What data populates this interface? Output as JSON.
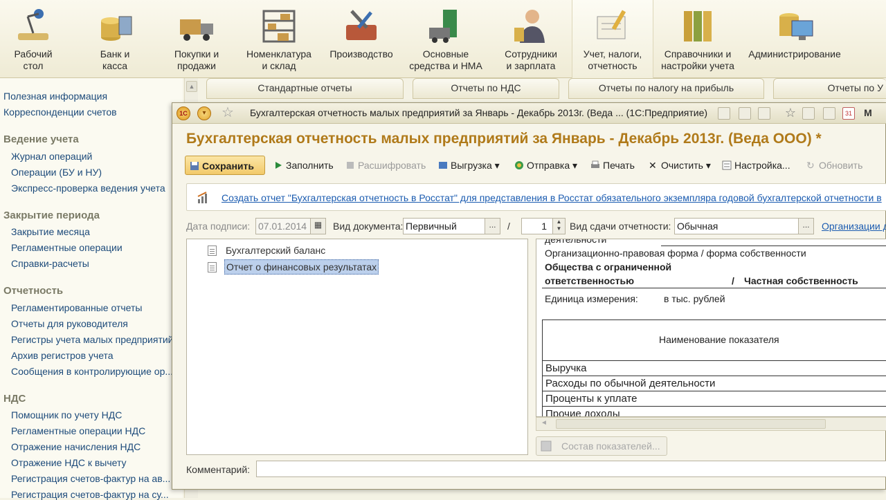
{
  "sections": [
    {
      "name": "desktop",
      "label": "Рабочий\nстол",
      "icon": "desk-lamp-icon"
    },
    {
      "name": "bank",
      "label": "Банк и\nкасса",
      "icon": "coins-icon"
    },
    {
      "name": "purchases",
      "label": "Покупки и\nпродажи",
      "icon": "truck-icon"
    },
    {
      "name": "nomenclature",
      "label": "Номенклатура\nи склад",
      "icon": "warehouse-icon"
    },
    {
      "name": "production",
      "label": "Производство",
      "icon": "tools-icon"
    },
    {
      "name": "assets",
      "label": "Основные\nсредства и НМА",
      "icon": "equipment-icon"
    },
    {
      "name": "staff",
      "label": "Сотрудники\nи зарплата",
      "icon": "employee-icon"
    },
    {
      "name": "accounting",
      "label": "Учет, налоги,\nотчетность",
      "icon": "report-icon"
    },
    {
      "name": "references",
      "label": "Справочники и\nнастройки учета",
      "icon": "binders-icon"
    },
    {
      "name": "admin",
      "label": "Администрирование",
      "icon": "computer-icon"
    }
  ],
  "left_panel": {
    "links_top": [
      "Полезная информация",
      "Корреспонденции счетов"
    ],
    "groups": [
      {
        "title": "Ведение учета",
        "items": [
          "Журнал операций",
          "Операции (БУ и НУ)",
          "Экспресс-проверка ведения учета"
        ]
      },
      {
        "title": "Закрытие периода",
        "items": [
          "Закрытие месяца",
          "Регламентные операции",
          "Справки-расчеты"
        ]
      },
      {
        "title": "Отчетность",
        "items": [
          "Регламентированные отчеты",
          "Отчеты для руководителя",
          "Регистры учета малых предприятий",
          "Архив регистров учета",
          "Сообщения в контролирующие ор..."
        ]
      },
      {
        "title": "НДС",
        "items": [
          "Помощник по учету НДС",
          "Регламентные операции НДС",
          "Отражение начисления НДС",
          "Отражение НДС к вычету",
          "Регистрация счетов-фактур на ав...",
          "Регистрация счетов-фактур на су..."
        ]
      }
    ]
  },
  "bg_tabs": [
    "Стандартные отчеты",
    "Отчеты по НДС",
    "Отчеты по налогу на прибыль",
    "Отчеты по У"
  ],
  "window": {
    "title": "Бухгалтерская отчетность малых предприятий за Январь - Декабрь 2013г. (Веда ...  (1С:Предприятие)",
    "doc_title": "Бухгалтерская отчетность малых предприятий за Январь - Декабрь 2013г. (Веда ООО) *",
    "toolbar": {
      "save": "Сохранить",
      "fill": "Заполнить",
      "decode": "Расшифровать",
      "export": "Выгрузка",
      "send": "Отправка",
      "print": "Печать",
      "clear": "Очистить",
      "settings": "Настройка...",
      "refresh": "Обновить"
    },
    "info_link": "Создать отчет \"Бухгалтерская отчетность в Росстат\" для представления в Росстат обязательного экземпляра годовой бухгалтерской отчетности в",
    "fields": {
      "sign_date_label": "Дата подписи:",
      "sign_date": "07.01.2014",
      "doc_type_label": "Вид документа:",
      "doc_type": "Первичный",
      "slash": "/",
      "number": "1",
      "delivery_label": "Вид сдачи отчетности:",
      "delivery": "Обычная",
      "org_link": "Организации д"
    },
    "tree": [
      "Бухгалтерский баланс",
      "Отчет о финансовых результатах"
    ],
    "report": {
      "cut_top": "деятельности",
      "opf_label": "Организационно-правовая форма / форма собственности",
      "opf_line1": "Общества с ограниченной",
      "opf_line2": "ответственностью",
      "slash": "/",
      "ownership": "Частная собственность",
      "unit_label": "Единица измерения:",
      "unit_value": "в тыс. рублей",
      "col_header": "Наименование показателя",
      "rows": [
        "Выручка",
        "Расходы по обычной деятельности",
        "Проценты к уплате",
        "Прочие доходы"
      ]
    },
    "sostav_button": "Состав показателей...",
    "comment_label": "Комментарий:"
  }
}
